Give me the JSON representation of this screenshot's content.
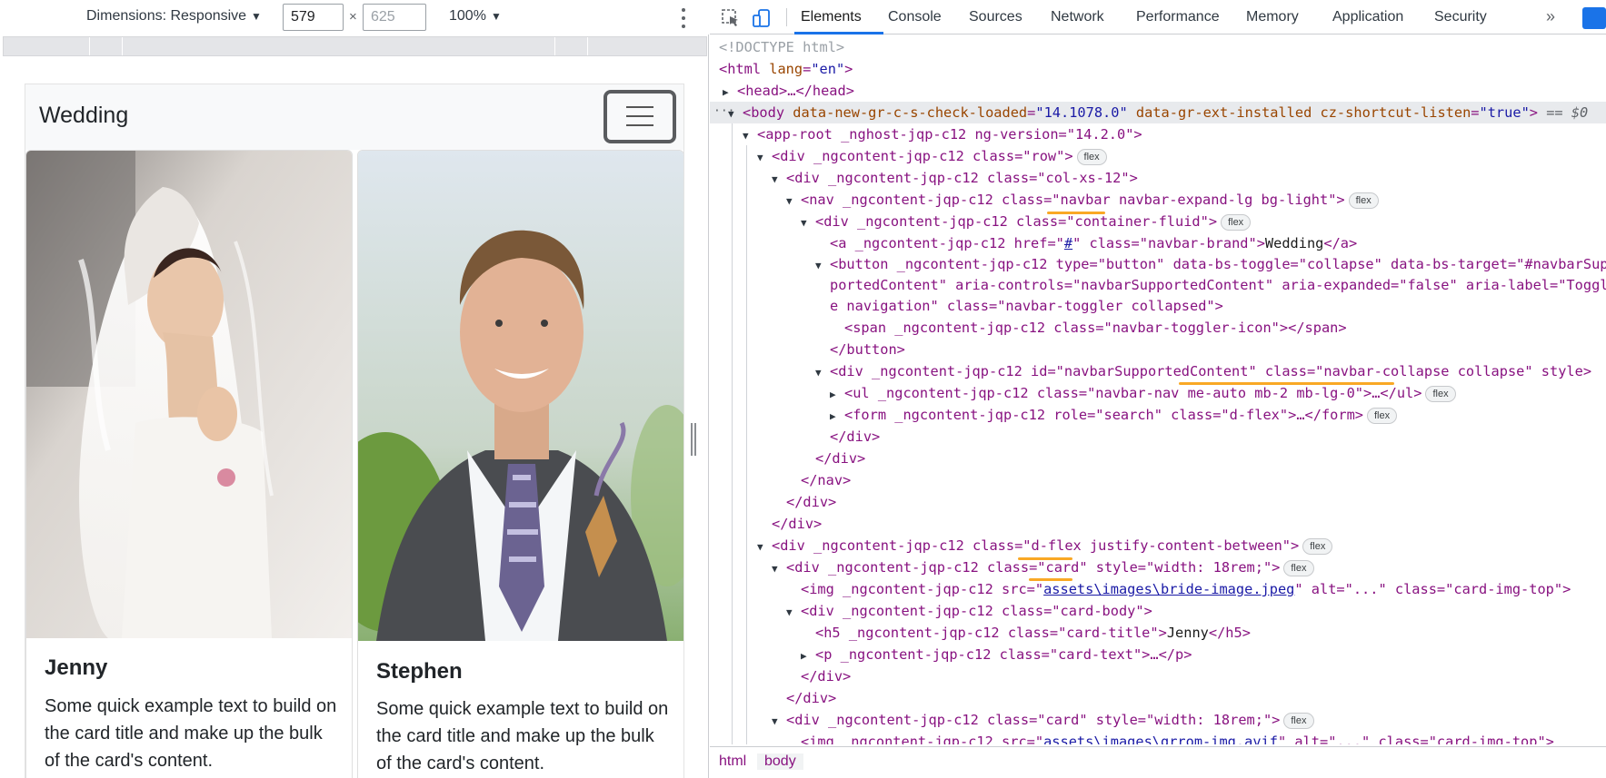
{
  "device_toolbar": {
    "dimensions_label": "Dimensions: Responsive",
    "width_value": "579",
    "height_placeholder": "625",
    "times": "×",
    "zoom": "100%"
  },
  "page": {
    "brand": "Wedding",
    "cards": [
      {
        "title": "Jenny",
        "text": "Some quick example text to build on the card title and make up the bulk of the card's content."
      },
      {
        "title": "Stephen",
        "text": "Some quick example text to build on the card title and make up the bulk of the card's content."
      }
    ]
  },
  "devtools": {
    "tabs": [
      "Elements",
      "Console",
      "Sources",
      "Network",
      "Performance",
      "Memory",
      "Application",
      "Security"
    ],
    "overflow": "»",
    "breadcrumbs": [
      "html",
      "body"
    ],
    "dom": {
      "l1": "<!DOCTYPE html>",
      "l2_tag": "<html ",
      "l2_attr": "lang",
      "l2_val": "\"en\"",
      "l2_end": ">",
      "l3": "<head>…</head>",
      "l4_tag": "<body ",
      "l4_a1": "data-new-gr-c-s-check-loaded",
      "l4_v1": "\"14.1078.0\"",
      "l4_a2": "data-gr-ext-installed",
      "l4_a3": "cz-shortcut-listen",
      "l4_v3": "\"true\"",
      "l4_end": ">",
      "l4_eq": "== $0",
      "app_root": "<app-root _nghost-jqp-c12 ng-version=\"14.2.0\">",
      "div_row": "<div _ngcontent-jqp-c12 class=\"row\">",
      "div_col": "<div _ngcontent-jqp-c12 class=\"col-xs-12\">",
      "nav": "<nav _ngcontent-jqp-c12 class=\"navbar navbar-expand-lg bg-light\">",
      "div_container": "<div _ngcontent-jqp-c12 class=\"container-fluid\">",
      "a_brand_pre": "<a _ngcontent-jqp-c12 href=\"",
      "a_brand_href": "#",
      "a_brand_mid": "\" class=\"navbar-brand\">",
      "a_brand_text": "Wedding",
      "a_brand_end": "</a>",
      "button_1": "<button _ngcontent-jqp-c12 type=\"button\" data-bs-toggle=\"collapse\" data-bs-target=\"#navbarSup",
      "button_2": "portedContent\" aria-controls=\"navbarSupportedContent\" aria-expanded=\"false\" aria-label=\"Toggl",
      "button_3": "e navigation\" class=\"navbar-toggler collapsed\">",
      "span_icon": "<span _ngcontent-jqp-c12 class=\"navbar-toggler-icon\"></span>",
      "button_close": "</button>",
      "div_collapse": "<div _ngcontent-jqp-c12 id=\"navbarSupportedContent\" class=\"navbar-collapse collapse\" style>",
      "ul_nav": "<ul _ngcontent-jqp-c12 class=\"navbar-nav me-auto mb-2 mb-lg-0\">…</ul>",
      "form": "<form _ngcontent-jqp-c12 role=\"search\" class=\"d-flex\">…</form>",
      "div_close": "</div>",
      "nav_close": "</nav>",
      "div_flex": "<div _ngcontent-jqp-c12 class=\"d-flex justify-content-between\">",
      "div_card": "<div _ngcontent-jqp-c12 class=\"card\" style=\"width: 18rem;\">",
      "img_pre": "<img _ngcontent-jqp-c12 src=\"",
      "img1_src": "assets\\images\\bride-image.jpeg",
      "img_post": "\" alt=\"...\" class=\"card-img-top\">",
      "div_card_body": "<div _ngcontent-jqp-c12 class=\"card-body\">",
      "h5_pre": "<h5 _ngcontent-jqp-c12 class=\"card-title\">",
      "h5_text": "Jenny",
      "h5_end": "</h5>",
      "p_text": "<p _ngcontent-jqp-c12 class=\"card-text\">…</p>",
      "img2_src": "assets\\images\\grrom-img.avif",
      "badge": "flex"
    }
  }
}
